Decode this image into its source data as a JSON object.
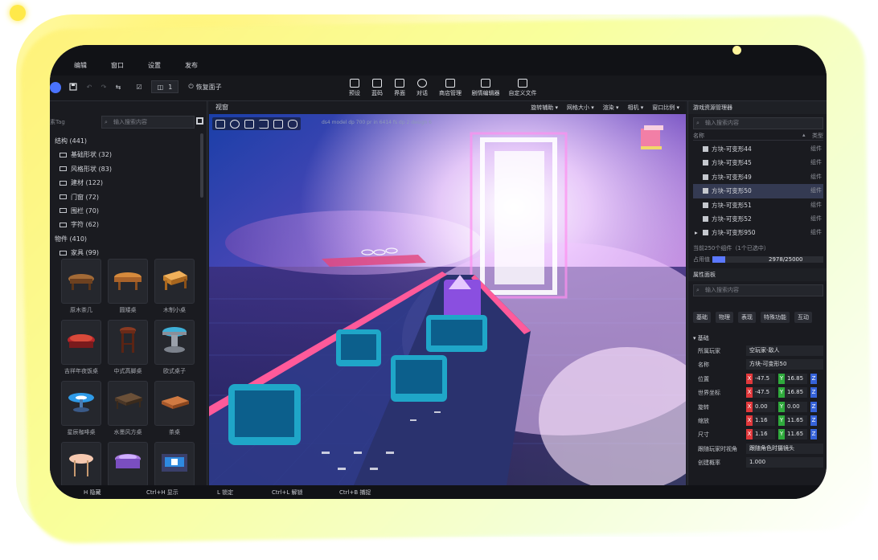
{
  "menu": [
    "编辑",
    "窗口",
    "设置",
    "发布"
  ],
  "toolbar": {
    "counter_value": "1",
    "reset_label": "恢复面子",
    "tools": [
      "预设",
      "蓝码",
      "界面",
      "对话",
      "商店管理",
      "剧情编辑器",
      "自定义文件"
    ]
  },
  "left_panel": {
    "tag_placeholder": "素Tag",
    "search_placeholder": "输入搜索内容",
    "tree": [
      {
        "label": "结构 (441)",
        "level": 0
      },
      {
        "label": "基础形状 (32)",
        "level": 1
      },
      {
        "label": "风格形状 (83)",
        "level": 1
      },
      {
        "label": "建材 (122)",
        "level": 1
      },
      {
        "label": "门窗 (72)",
        "level": 1
      },
      {
        "label": "围栏 (70)",
        "level": 1
      },
      {
        "label": "字符 (62)",
        "level": 1
      },
      {
        "label": "物件 (410)",
        "level": 0
      },
      {
        "label": "家具 (99)",
        "level": 1
      }
    ],
    "assets": [
      "原木茶几",
      "圆矮桌",
      "木制小桌",
      "吉祥年夜饭桌",
      "中式高脚桌",
      "欧式桌子",
      "星辰咖啡桌",
      "水墨风方桌",
      "茶桌",
      "",
      "",
      ""
    ]
  },
  "viewport": {
    "title": "视窗",
    "info": "ds4 model dp 700 pr in 6414   fs dp 2  design  6",
    "options": [
      "旋转辅助",
      "网格大小",
      "渲染",
      "相机",
      "窗口比例"
    ]
  },
  "right_panel": {
    "explorer_title": "游戏资源管理器",
    "search_placeholder": "输入搜索内容",
    "col_name": "名称",
    "col_type": "类型",
    "rows": [
      {
        "name": "方块-可变形44",
        "type": "组件",
        "selected": false,
        "expand": false
      },
      {
        "name": "方块-可变形45",
        "type": "组件",
        "selected": false,
        "expand": false
      },
      {
        "name": "方块-可变形49",
        "type": "组件",
        "selected": false,
        "expand": false
      },
      {
        "name": "方块-可变形50",
        "type": "组件",
        "selected": true,
        "expand": false
      },
      {
        "name": "方块-可变形51",
        "type": "组件",
        "selected": false,
        "expand": false
      },
      {
        "name": "方块-可变形52",
        "type": "组件",
        "selected": false,
        "expand": false
      },
      {
        "name": "方块-可变形950",
        "type": "组件",
        "selected": false,
        "expand": true
      }
    ],
    "count_text": "当前250个组件（1个已选中）",
    "usage_label": "占用值",
    "usage_value": "2978/25000",
    "usage_fraction": 0.119,
    "props_title": "属性面板",
    "props_search": "输入搜索内容",
    "tabs": [
      "基础",
      "物理",
      "表现",
      "特殊功能",
      "互动"
    ],
    "section": "基础",
    "owner_label": "所属玩家",
    "owner_value": "空玩家-敌人",
    "name_label": "名称",
    "name_value": "方块-可变形50",
    "vectors": [
      {
        "label": "位置",
        "x": "-47.5",
        "y": "16.85"
      },
      {
        "label": "世界坐标",
        "x": "-47.5",
        "y": "16.85"
      },
      {
        "label": "旋转",
        "x": "0.00",
        "y": "0.00"
      },
      {
        "label": "缩放",
        "x": "1.16",
        "y": "11.65"
      },
      {
        "label": "尺寸",
        "x": "1.16",
        "y": "11.65"
      }
    ],
    "follow_label": "跟随玩家时视角",
    "follow_value": "跟随角色时摄镜头",
    "create_label": "创建概率",
    "create_value": "1.000"
  },
  "statusbar": [
    {
      "text": "H 隐藏"
    },
    {
      "text": "Ctrl+H 显示"
    },
    {
      "text": "L 锁定"
    },
    {
      "text": "Ctrl+L 解锁"
    },
    {
      "text": "Ctrl+B 捕捉"
    }
  ],
  "colors": {
    "accent": "#5b78ff",
    "selected_row": "#343a52",
    "x_axis": "#e0383b",
    "y_axis": "#2faa3c",
    "z_axis": "#3562d8"
  }
}
